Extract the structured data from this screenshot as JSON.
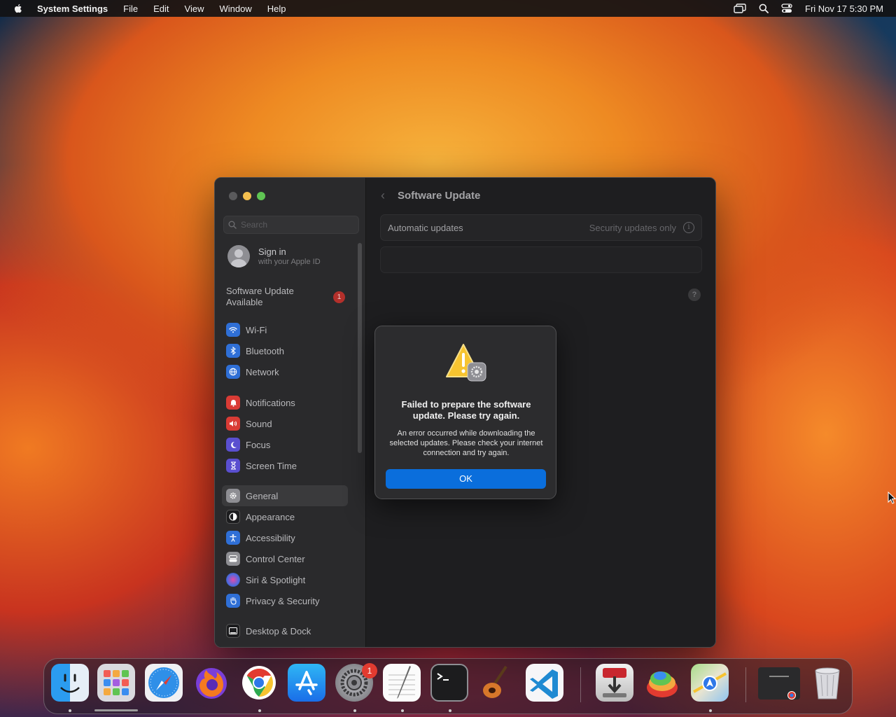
{
  "menubar": {
    "apple_icon": "apple-logo-icon",
    "app_name": "System Settings",
    "menus": [
      "File",
      "Edit",
      "View",
      "Window",
      "Help"
    ],
    "status_icons": [
      "screen-mirroring-icon",
      "spotlight-search-icon",
      "control-center-icon"
    ],
    "datetime": "Fri Nov 17  5:30 PM"
  },
  "window": {
    "search_placeholder": "Search",
    "account": {
      "title": "Sign in",
      "subtitle": "with your Apple ID"
    },
    "update_notice": {
      "label": "Software Update Available",
      "badge": "1"
    },
    "sidebar_groups": [
      [
        {
          "label": "Wi-Fi",
          "icon": "wifi-icon",
          "color": "#2f6fd6"
        },
        {
          "label": "Bluetooth",
          "icon": "bluetooth-icon",
          "color": "#2f6fd6"
        },
        {
          "label": "Network",
          "icon": "globe-icon",
          "color": "#2f6fd6"
        }
      ],
      [
        {
          "label": "Notifications",
          "icon": "bell-icon",
          "color": "#d93b35"
        },
        {
          "label": "Sound",
          "icon": "speaker-icon",
          "color": "#d93b35"
        },
        {
          "label": "Focus",
          "icon": "moon-icon",
          "color": "#5a4fd0"
        },
        {
          "label": "Screen Time",
          "icon": "hourglass-icon",
          "color": "#5a4fd0"
        }
      ],
      [
        {
          "label": "General",
          "icon": "gear-icon",
          "color": "#8e8e93",
          "selected": true
        },
        {
          "label": "Appearance",
          "icon": "appearance-icon",
          "color": "#1c1c1e"
        },
        {
          "label": "Accessibility",
          "icon": "accessibility-icon",
          "color": "#2f6fd6"
        },
        {
          "label": "Control Center",
          "icon": "control-center-icon",
          "color": "#8e8e93"
        },
        {
          "label": "Siri & Spotlight",
          "icon": "siri-icon",
          "color": "#7a3fc7"
        },
        {
          "label": "Privacy & Security",
          "icon": "hand-icon",
          "color": "#2f6fd6"
        }
      ],
      [
        {
          "label": "Desktop & Dock",
          "icon": "dock-icon",
          "color": "#1c1c1e"
        }
      ]
    ],
    "content": {
      "back_icon": "chevron-left-icon",
      "title": "Software Update",
      "automatic_updates_label": "Automatic updates",
      "automatic_updates_value": "Security updates only",
      "info_icon": "info-icon",
      "help_icon": "help-icon"
    }
  },
  "alert": {
    "icon": "warning-settings-icon",
    "heading": "Failed to prepare the software update. Please try again.",
    "message": "An error occurred while downloading the selected updates. Please check your internet connection and try again.",
    "ok_label": "OK"
  },
  "dock": {
    "apps": [
      {
        "name": "Finder",
        "icon": "finder-icon",
        "running": true
      },
      {
        "name": "Launchpad",
        "icon": "launchpad-icon",
        "running": false
      },
      {
        "name": "Safari",
        "icon": "safari-icon",
        "running": false
      },
      {
        "name": "Firefox",
        "icon": "firefox-icon",
        "running": false
      },
      {
        "name": "Google Chrome",
        "icon": "chrome-icon",
        "running": true
      },
      {
        "name": "App Store",
        "icon": "app-store-icon",
        "running": false
      },
      {
        "name": "System Settings",
        "icon": "system-settings-icon",
        "running": true,
        "badge": "1"
      },
      {
        "name": "TextEdit",
        "icon": "textedit-icon",
        "running": true
      },
      {
        "name": "Terminal",
        "icon": "terminal-icon",
        "running": true
      },
      {
        "name": "GarageBand",
        "icon": "garageband-icon",
        "running": false
      },
      {
        "name": "Visual Studio Code",
        "icon": "vscode-icon",
        "running": false
      },
      {
        "name": "Transmission",
        "icon": "transmission-icon",
        "running": false
      },
      {
        "name": "Plasticity",
        "icon": "plasticity-icon",
        "running": false
      },
      {
        "name": "Maps",
        "icon": "maps-icon",
        "running": true
      },
      {
        "name": "Minimized Chrome Window",
        "icon": "minimized-window-icon",
        "running": false
      },
      {
        "name": "Trash",
        "icon": "trash-icon",
        "running": false
      }
    ]
  }
}
